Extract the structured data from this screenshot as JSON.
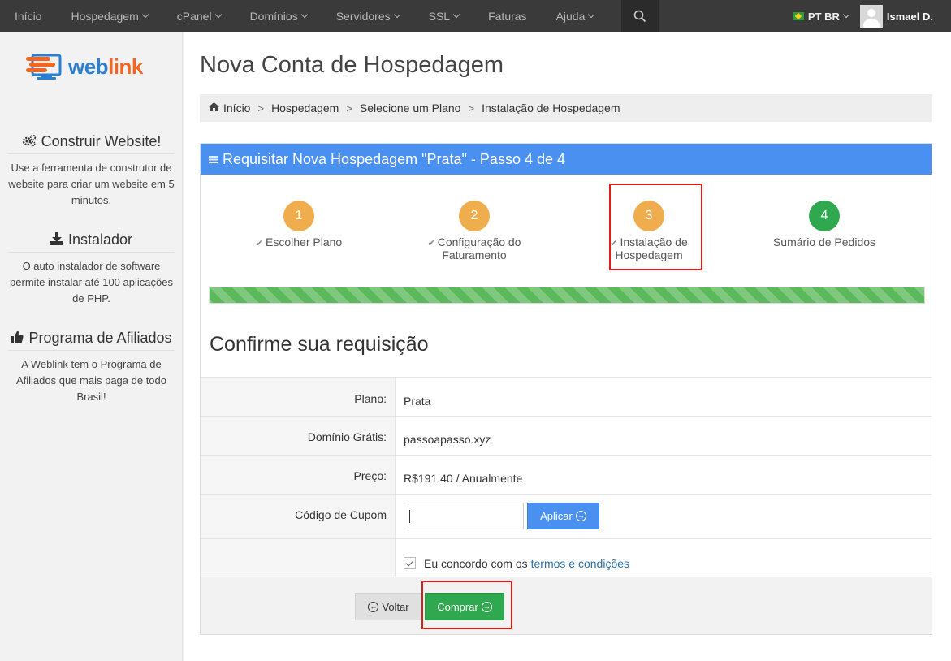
{
  "topnav": {
    "items": [
      {
        "label": "Início",
        "has_dropdown": false
      },
      {
        "label": "Hospedagem",
        "has_dropdown": true
      },
      {
        "label": "cPanel",
        "has_dropdown": true
      },
      {
        "label": "Domínios",
        "has_dropdown": true
      },
      {
        "label": "Servidores",
        "has_dropdown": true
      },
      {
        "label": "SSL",
        "has_dropdown": true
      },
      {
        "label": "Faturas",
        "has_dropdown": false
      },
      {
        "label": "Ajuda",
        "has_dropdown": true
      }
    ],
    "search_icon": "search-icon",
    "language": "PT BR",
    "user_name": "Ismael D.",
    "colors": {
      "bar": "#3a3a3a",
      "text": "#b8b8b8"
    }
  },
  "sidebar": {
    "logo": {
      "text_main": "web",
      "text_accent": "link"
    },
    "blocks": [
      {
        "icon": "gears-icon",
        "title": "Construir Website!",
        "text": "Use a ferramenta de construtor de website para criar um website em 5 minutos."
      },
      {
        "icon": "download-icon",
        "title": "Instalador",
        "text": "O auto instalador de software permite instalar até 100 aplicações de PHP."
      },
      {
        "icon": "thumbs-up-icon",
        "title": "Programa de Afiliados",
        "text": "A Weblink tem o Programa de Afiliados que mais paga de todo Brasil!"
      }
    ]
  },
  "page": {
    "title": "Nova Conta de Hospedagem",
    "breadcrumb": [
      "Início",
      "Hospedagem",
      "Selecione um Plano",
      "Instalação de Hospedagem"
    ]
  },
  "panel": {
    "heading": "Requisitar Nova Hospedagem \"Prata\" - Passo 4 de 4",
    "accent_color": "#4a90f0",
    "steps": [
      {
        "number": "1",
        "label": "Escolher Plano",
        "completed": true
      },
      {
        "number": "2",
        "label": "Configuração do Faturamento",
        "completed": true
      },
      {
        "number": "3",
        "label": "Instalação de Hospedagem",
        "completed": true
      },
      {
        "number": "4",
        "label": "Sumário de Pedidos",
        "completed": false
      }
    ],
    "progress": 1.0,
    "confirm_title": "Confirme sua requisição",
    "fields": {
      "plan_label": "Plano:",
      "plan_value": "Prata",
      "domain_label": "Domínio Grátis:",
      "domain_value": "passoapasso.xyz",
      "price_label": "Preço:",
      "price_value": "R$191.40 / Anualmente",
      "coupon_label": "Código de Cupom",
      "coupon_value": "",
      "apply_label": "Aplicar"
    },
    "terms": {
      "prefix": "Eu concordo com os",
      "link": "termos e condições",
      "checked": true
    },
    "buttons": {
      "back": "Voltar",
      "buy": "Comprar"
    },
    "colors": {
      "step_done": "#f0ad4e",
      "step_active": "#2fa84f",
      "highlight": "#e01b1b"
    }
  }
}
